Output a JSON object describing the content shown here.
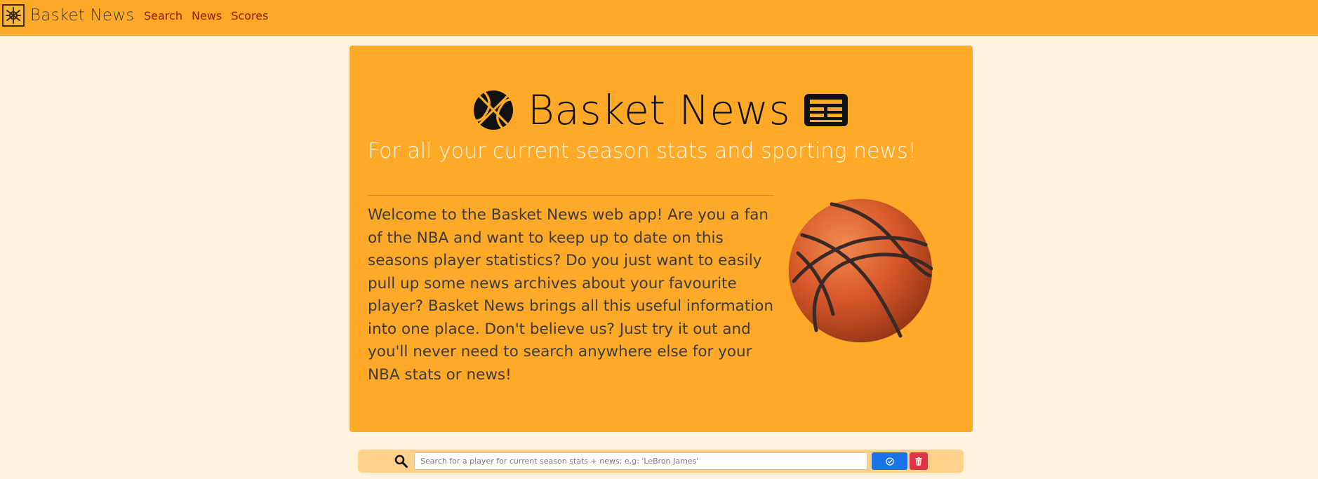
{
  "navbar": {
    "brand_name": "Basket News",
    "brand_logo_icon": "hieroglyph-logo-icon",
    "links": [
      {
        "label": "Search"
      },
      {
        "label": "News"
      },
      {
        "label": "Scores"
      }
    ]
  },
  "hero": {
    "title": "Basket News",
    "title_left_icon": "basketball-icon",
    "title_right_icon": "newspaper-icon",
    "lead": "For all your current season stats and sporting news!",
    "intro": "Welcome to the Basket News web app! Are you a fan of the NBA and want to keep up to date on this seasons player statistics? Do you just want to easily pull up some news archives about your favourite player? Basket News brings all this useful information into one place. Don't believe us? Just try it out and you'll never need to search anywhere else for your NBA stats or news!",
    "image": "basketball-image"
  },
  "search": {
    "icon": "search-icon",
    "placeholder": "Search for a player for current season stats + news; e.g: 'LeBron James'",
    "value": "",
    "submit_icon": "check-circle-icon",
    "clear_icon": "trash-icon"
  },
  "colors": {
    "page_background": "#fff3dd",
    "navbar": "#ffa929",
    "jumbotron": "#ffa929",
    "search_bar": "#ffd18a",
    "nav_link": "#8a1d0b",
    "submit_button": "#1a73e8",
    "clear_button": "#dc3545"
  }
}
